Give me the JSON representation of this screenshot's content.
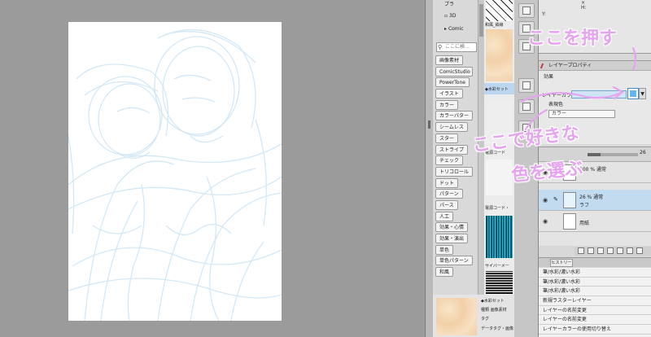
{
  "material_panel": {
    "tree": [
      "ブラ",
      "3D",
      "Comic"
    ],
    "search_placeholder": "ここに検…",
    "tags": [
      "画像素材",
      "ComicStudio",
      "PowerTone",
      "イラスト",
      "カラー",
      "カラーパター",
      "シームレス",
      "スター",
      "ストライプ",
      "チェック",
      "トリコロール",
      "ドット",
      "パターン",
      "パース",
      "人工",
      "効果・心情",
      "効果・演出",
      "単色",
      "単色パターン",
      "和風"
    ],
    "thumb_labels": [
      "和風_鉄線",
      "◆水彩セット",
      "電源コード",
      "電源コード・",
      "サイバーメー"
    ],
    "info": [
      "◆水彩セット",
      "種類 画像素材",
      "タグ",
      "データタグ・画像"
    ]
  },
  "navigator": {
    "h_label": "H:",
    "y_label": "Y:",
    "x_icon": "×"
  },
  "layer_property": {
    "title": "レイヤープロパティ",
    "effect_label": "効果",
    "layer_color_label": "レイヤーカラー",
    "expression_label": "表現色",
    "blend_value": "カラー",
    "layer_color_hex": "#61b6f0"
  },
  "layer_panel": {
    "opacity_value": "26",
    "opacity_fraction": 0.26,
    "layers": [
      {
        "name": "100 % 通常",
        "sub": ""
      },
      {
        "name": "26 % 通常",
        "sub": "ラフ"
      },
      {
        "name": "",
        "sub": "用紙"
      }
    ]
  },
  "history": {
    "tab_label": "ヒストリー",
    "items": [
      "筆/水彩/濃い水彩",
      "筆/水彩/濃い水彩",
      "筆/水彩/濃い水彩",
      "新規ラスターレイヤー",
      "レイヤーの名前変更",
      "レイヤーの名前変更",
      "レイヤーカラーの使用切り替え"
    ]
  },
  "annotations": {
    "top": "ここを押す",
    "middle": "ここで好きな",
    "bottom": "色を選ぶ",
    "color": "#e6a4f0"
  }
}
